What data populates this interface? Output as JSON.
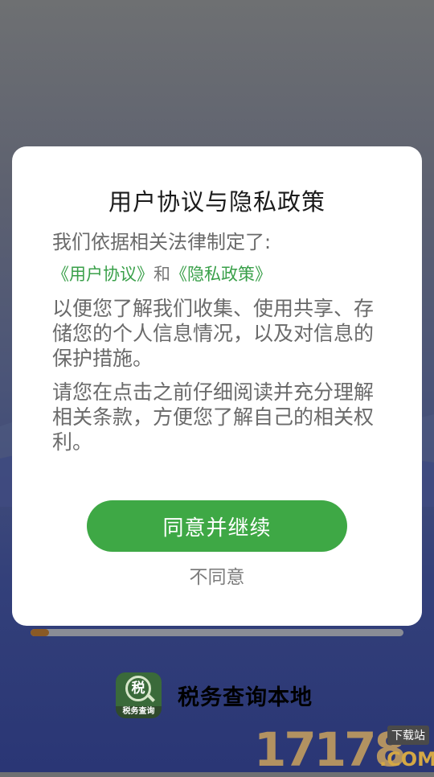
{
  "background": {
    "colors": {
      "top": "#6e7072",
      "bottom": "#2a3675"
    }
  },
  "loading": {
    "progress": 0.05,
    "fill_color": "#8a5a25"
  },
  "dialog": {
    "title": "用户协议与隐私政策",
    "intro": "我们依据相关法律制定了:",
    "user_agreement_link": "《用户协议》",
    "joiner": "和",
    "privacy_policy_link": "《隐私政策》",
    "paragraph1": "以便您了解我们收集、使用共享、存储您的个人信息情况，以及对信息的保护措施。",
    "paragraph2": "请您在点击之前仔细阅读并充分理解相关条款，方便您了解自己的相关权利。",
    "agree_label": "同意并继续",
    "disagree_label": "不同意",
    "colors": {
      "link": "#3aa04a",
      "primary_button": "#3ea845"
    }
  },
  "app": {
    "icon": "tax-query-app-icon",
    "icon_caption": "税务查询",
    "icon_glyph": "税",
    "name": "税务查询本地"
  },
  "watermark": {
    "number": "17178",
    "tag": "下载站",
    "suffix": ".COM"
  }
}
